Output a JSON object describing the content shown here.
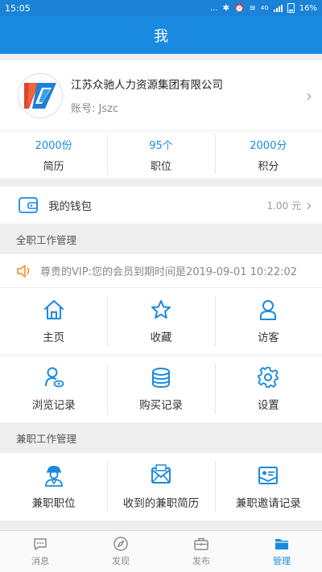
{
  "status_bar": {
    "time": "15:05",
    "dots": "...",
    "network": "4G",
    "battery": "16%"
  },
  "header": {
    "title": "我"
  },
  "profile": {
    "company": "江苏众驰人力资源集团有限公司",
    "account": "账号: Jszc"
  },
  "stats": [
    {
      "value": "2000份",
      "label": "简历"
    },
    {
      "value": "95个",
      "label": "职位"
    },
    {
      "value": "2000分",
      "label": "积分"
    }
  ],
  "wallet": {
    "label": "我的钱包",
    "amount": "1.00 元"
  },
  "fulltime": {
    "title": "全职工作管理",
    "notice": "尊贵的VIP:您的会员到期时间是2019-09-01 10:22:02",
    "items": [
      {
        "label": "主页",
        "icon": "home-icon"
      },
      {
        "label": "收藏",
        "icon": "star-icon"
      },
      {
        "label": "访客",
        "icon": "visitor-icon"
      },
      {
        "label": "浏览记录",
        "icon": "browse-history-icon"
      },
      {
        "label": "购买记录",
        "icon": "coins-icon"
      },
      {
        "label": "设置",
        "icon": "gear-icon"
      }
    ]
  },
  "parttime": {
    "title": "兼职工作管理",
    "items": [
      {
        "label": "兼职职位",
        "icon": "worker-icon"
      },
      {
        "label": "收到的兼职简历",
        "icon": "mail-icon"
      },
      {
        "label": "兼职邀请记录",
        "icon": "invite-card-icon"
      }
    ]
  },
  "tabbar": {
    "items": [
      {
        "label": "消息",
        "icon": "chat-icon",
        "active": false
      },
      {
        "label": "发现",
        "icon": "compass-icon",
        "active": false
      },
      {
        "label": "发布",
        "icon": "briefcase-icon",
        "active": false
      },
      {
        "label": "管理",
        "icon": "folder-icon",
        "active": true
      }
    ]
  },
  "colors": {
    "primary": "#1a8ae0",
    "status_bar": "#1a83d8",
    "notice_icon": "#f08a24",
    "background": "#eeeeee"
  }
}
